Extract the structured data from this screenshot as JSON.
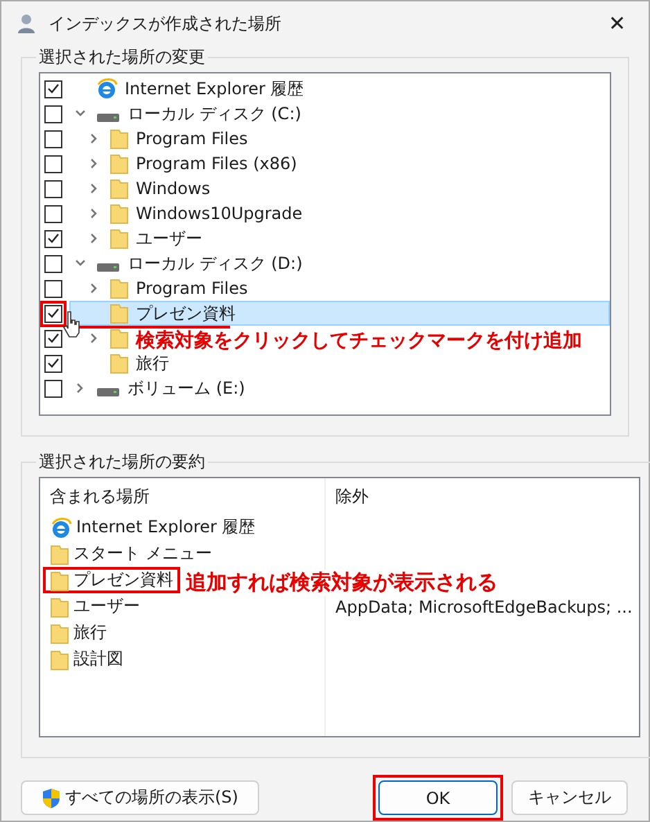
{
  "window": {
    "title": "インデックスが作成された場所",
    "close": "✕"
  },
  "change_group": {
    "title": "選択された場所の変更",
    "tree": [
      {
        "label": "Internet Explorer 履歴",
        "kind": "ie",
        "checked": true,
        "selected": false
      },
      {
        "label": "ローカル ディスク (C:)",
        "kind": "drive",
        "checked": false,
        "selected": false,
        "expanded": true,
        "children": [
          {
            "label": "Program Files",
            "kind": "folder",
            "checked": false,
            "selected": false,
            "expanded": false
          },
          {
            "label": "Program Files (x86)",
            "kind": "folder",
            "checked": false,
            "selected": false,
            "expanded": false
          },
          {
            "label": "Windows",
            "kind": "folder",
            "checked": false,
            "selected": false,
            "expanded": false
          },
          {
            "label": "Windows10Upgrade",
            "kind": "folder",
            "checked": false,
            "selected": false,
            "expanded": false
          },
          {
            "label": "ユーザー",
            "kind": "folder",
            "checked": true,
            "selected": false,
            "expanded": false
          }
        ]
      },
      {
        "label": "ローカル ディスク (D:)",
        "kind": "drive",
        "checked": false,
        "selected": false,
        "expanded": true,
        "children": [
          {
            "label": "Program Files",
            "kind": "folder",
            "checked": false,
            "selected": false,
            "expanded": false
          },
          {
            "label": "プレゼン資料",
            "kind": "folder",
            "checked": true,
            "selected": true,
            "annotated": true
          },
          {
            "kind": "folder",
            "checked": true,
            "selected": false,
            "expanded": false
          },
          {
            "label": "旅行",
            "kind": "folder",
            "checked": true,
            "selected": false
          }
        ]
      },
      {
        "label": "ボリューム (E:)",
        "kind": "drive",
        "checked": false,
        "selected": false,
        "expanded": false
      }
    ]
  },
  "summary_group": {
    "title": "選択された場所の要約",
    "columns": [
      "含まれる場所",
      "除外"
    ],
    "rows": [
      {
        "kind": "ie",
        "included": "Internet Explorer 履歴"
      },
      {
        "kind": "folder",
        "included": "スタート メニュー"
      },
      {
        "kind": "folder",
        "included": "プレゼン資料",
        "annotated": true
      },
      {
        "kind": "folder",
        "included": "ユーザー",
        "excluded": "AppData; MicrosoftEdgeBackups; ..."
      },
      {
        "kind": "folder",
        "included": "旅行"
      },
      {
        "kind": "folder",
        "included": "設計図"
      }
    ]
  },
  "buttons": [
    {
      "label": "すべての場所の表示(S)",
      "kind": "shield",
      "annotated": false
    },
    {
      "label": "OK",
      "kind": "default",
      "annotated": true
    },
    {
      "label": "キャンセル",
      "kind": "plain",
      "annotated": false
    }
  ],
  "annotations": [
    "検索対象をクリックしてチェックマークを付け追加",
    "追加すれば検索対象が表示される"
  ]
}
